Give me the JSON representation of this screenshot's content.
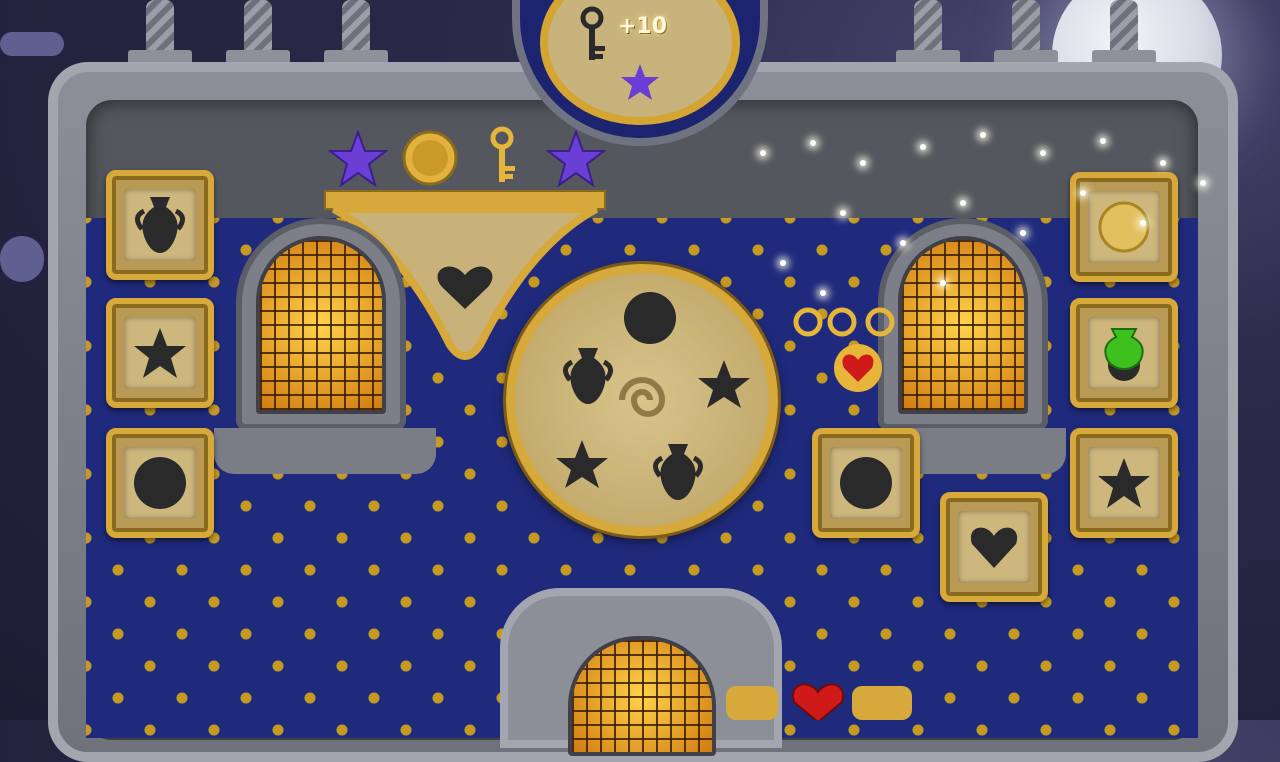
{
  "hud": {
    "score_popup": "+10"
  },
  "collectibles_bar": {
    "items": [
      "star-purple",
      "gold-coin",
      "gold-key",
      "star-purple"
    ]
  },
  "left_tiles": [
    "urn",
    "star",
    "circle"
  ],
  "right_tiles": [
    "coin",
    "urn",
    "star"
  ],
  "center_tiles": [
    "circle",
    "heart"
  ],
  "dial_slots": [
    "circle",
    "urn",
    "star",
    "star",
    "urn",
    "spiral-center"
  ],
  "bottom_items": [
    "heart"
  ],
  "colors": {
    "wallpaper": "#1f2a7c",
    "gold": "#d6a93a",
    "stone": "#8c8f98",
    "star_purple": "#6b3fd6",
    "heart_red": "#d01a1a"
  }
}
